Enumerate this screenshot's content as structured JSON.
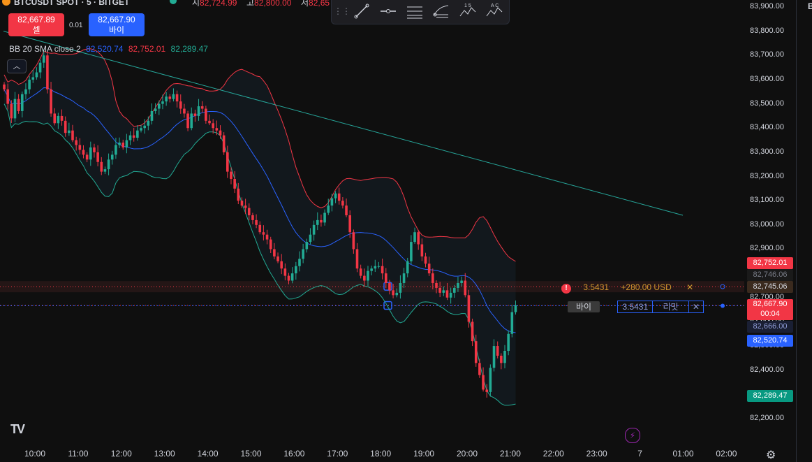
{
  "header": {
    "symbol": "BTCUSDT SPOT · 5 · BITGET",
    "open_key": "시",
    "open_val": "82,724.99",
    "high_key": "고",
    "high_val": "82,800.00",
    "low_key": "저",
    "low_val": "82,65"
  },
  "trade": {
    "sell_price": "82,667.89",
    "sell_label": "셀",
    "spread": "0.01",
    "buy_price": "82,667.90",
    "buy_label": "바이"
  },
  "indicator": {
    "name": "BB 20 SMA close 2",
    "basis": "82,520.74",
    "upper": "82,752.01",
    "lower": "82,289.47",
    "colors": {
      "basis": "#2962ff",
      "upper": "#f23645",
      "lower": "#22ab94"
    }
  },
  "toolbar": {
    "tools": [
      "drag-handle-icon",
      "trend-line-icon",
      "horizontal-ray-icon",
      "parallel-channel-icon",
      "fib-icon",
      "pattern-15-icon",
      "pattern-ac-icon"
    ],
    "pattern_label_1": "1 5",
    "pattern_label_2": "A C"
  },
  "price_axis": {
    "labels": [
      "83,900.00",
      "83,800.00",
      "83,700.00",
      "83,600.00",
      "83,500.00",
      "83,400.00",
      "83,300.00",
      "83,200.00",
      "83,100.00",
      "83,000.00",
      "82,900.00",
      "82,800.00",
      "82,700.00",
      "82,600.00",
      "82,500.00",
      "82,400.00",
      "82,300.00",
      "82,200.00"
    ],
    "tags": {
      "upper": "82,752.01",
      "tp_ghost": "82,746.06",
      "tp": "82,745.06",
      "last": "82,667.90",
      "countdown": "00:04",
      "entry": "82,666.00",
      "basis": "82,520.74",
      "lower": "82,289.47"
    }
  },
  "orders": {
    "tp": {
      "qty": "3.5431",
      "pnl": "+280.00 USD",
      "close": "✕"
    },
    "entry": {
      "side": "바이",
      "qty": "3.5431",
      "kind": "리밋",
      "close": "✕"
    }
  },
  "time_axis": {
    "labels": [
      "10:00",
      "11:00",
      "12:00",
      "13:00",
      "14:00",
      "15:00",
      "16:00",
      "17:00",
      "18:00",
      "19:00",
      "20:00",
      "21:00",
      "22:00",
      "23:00",
      "7",
      "01:00",
      "02:00"
    ]
  },
  "right_panel": {
    "label": "B"
  },
  "chart_data": {
    "type": "candlestick",
    "title": "BTCUSDT SPOT · 5 · BITGET",
    "ylim": [
      82150,
      83950
    ],
    "x_ticks": [
      "10:00",
      "11:00",
      "12:00",
      "13:00",
      "14:00",
      "15:00",
      "16:00",
      "17:00",
      "18:00",
      "19:00",
      "20:00",
      "21:00",
      "22:00",
      "23:00",
      "7",
      "01:00",
      "02:00"
    ],
    "close_path": [
      83560,
      83500,
      83440,
      83520,
      83470,
      83540,
      83560,
      83600,
      83610,
      83630,
      83670,
      83700,
      83560,
      83460,
      83420,
      83450,
      83430,
      83380,
      83390,
      83350,
      83330,
      83310,
      83290,
      83270,
      83320,
      83300,
      83260,
      83220,
      83230,
      83270,
      83290,
      83330,
      83340,
      83320,
      83350,
      83370,
      83360,
      83390,
      83400,
      83410,
      83430,
      83470,
      83480,
      83500,
      83510,
      83530,
      83520,
      83540,
      83510,
      83480,
      83460,
      83400,
      83460,
      83450,
      83490,
      83480,
      83430,
      83420,
      83400,
      83390,
      83370,
      83300,
      83220,
      83190,
      83150,
      83100,
      83080,
      83070,
      83040,
      83020,
      83000,
      82970,
      82960,
      82940,
      82900,
      82870,
      82850,
      82820,
      82790,
      82770,
      82800,
      82830,
      82860,
      82900,
      82930,
      82960,
      83000,
      83020,
      83010,
      83050,
      83080,
      83110,
      83130,
      83100,
      83080,
      83040,
      82970,
      82900,
      82820,
      82790,
      82770,
      82810,
      82820,
      82830,
      82830,
      82800,
      82760,
      82730,
      82710,
      82720,
      82760,
      82800,
      82850,
      82930,
      82970,
      82920,
      82870,
      82840,
      82800,
      82760,
      82740,
      82720,
      82730,
      82700,
      82720,
      82740,
      82760,
      82770,
      82710,
      82600,
      82520,
      82430,
      82380,
      82320,
      82310,
      82410,
      82500,
      82460,
      82430,
      82480,
      82550,
      82640,
      82668
    ],
    "overlays": {
      "bb_basis_last": 82520.74,
      "bb_upper_last": 82752.01,
      "bb_lower_last": 82289.47,
      "trendline": {
        "from": [
          "09:40",
          83800
        ],
        "to": [
          "00:10",
          83040
        ]
      }
    },
    "levels": {
      "take_profit": 82745.06,
      "last_price": 82667.9,
      "entry_limit": 82666.0
    },
    "grid": false,
    "legend": "top-left"
  }
}
